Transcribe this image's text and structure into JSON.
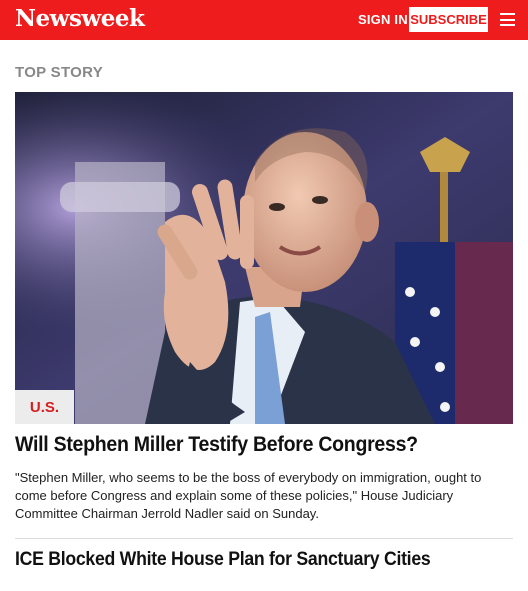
{
  "brand": {
    "logo_text": "Newsweek",
    "accent": "#ee1c1c"
  },
  "header": {
    "signin_label": "SIGN IN",
    "subscribe_label": "SUBSCRIBE"
  },
  "section": {
    "label": "TOP STORY"
  },
  "top_story": {
    "category": "U.S.",
    "headline": "Will Stephen Miller Testify Before Congress?",
    "summary": "\"Stephen Miller, who seems to be the boss of everybody on immigration, ought to come before Congress and explain some of these policies,\" House Judiciary Committee Chairman Jerrold Nadler said on Sunday."
  },
  "next_story": {
    "headline": "ICE Blocked White House Plan for Sanctuary Cities"
  }
}
